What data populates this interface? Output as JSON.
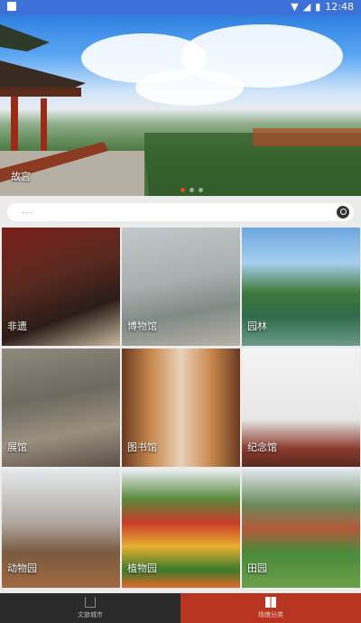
{
  "status_bar": {
    "time": "12:48"
  },
  "banner": {
    "caption": "故宫",
    "slide_count": 3,
    "active_slide": 1
  },
  "search": {
    "placeholder": "...."
  },
  "categories": [
    {
      "label": "非遗",
      "icon": "heritage-photo"
    },
    {
      "label": "博物馆",
      "icon": "museum-photo"
    },
    {
      "label": "园林",
      "icon": "garden-photo"
    },
    {
      "label": "展馆",
      "icon": "exhibition-photo"
    },
    {
      "label": "图书馆",
      "icon": "library-photo"
    },
    {
      "label": "纪念馆",
      "icon": "memorial-photo"
    },
    {
      "label": "动物园",
      "icon": "zoo-photo"
    },
    {
      "label": "植物园",
      "icon": "botanical-photo"
    },
    {
      "label": "田园",
      "icon": "countryside-photo"
    }
  ],
  "tabs": [
    {
      "label": "文旅城市",
      "active": false
    },
    {
      "label": "场馆分类",
      "active": true
    }
  ],
  "colors": {
    "status": "#3d71d8",
    "active_tab": "#b73520",
    "tab_bar": "#2a2a2a"
  }
}
